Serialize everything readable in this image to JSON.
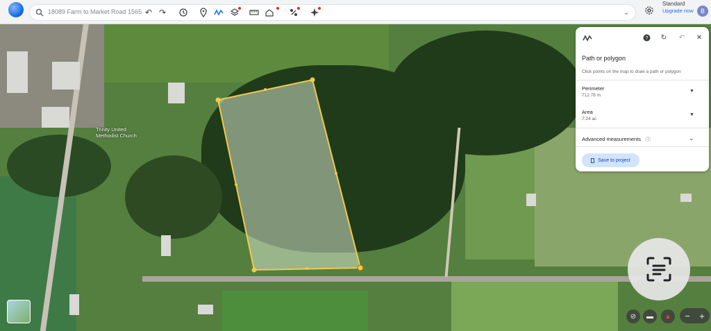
{
  "search": {
    "value": "18089 Farm to Market Road 1565"
  },
  "toolbar": {
    "tools": [
      "undo-icon",
      "redo-icon",
      "history-icon",
      "pin-icon",
      "path-icon",
      "layers-icon",
      "ruler-icon",
      "voyager-icon",
      "data-layers-icon",
      "ai-sparkle-icon"
    ]
  },
  "account": {
    "plan": "Standard",
    "upgrade_label": "Upgrade now",
    "avatar_letter": "B"
  },
  "measure_panel": {
    "title": "Path or polygon",
    "instruction": "Click points on the map to draw a path or polygon",
    "perimeter_label": "Perimeter",
    "perimeter_value": "712.78 m",
    "area_label": "Area",
    "area_value": "7.24 ac",
    "advanced_label": "Advanced measurements",
    "save_label": "Save to project"
  },
  "map": {
    "church_label": "Trinity United Methodist Church",
    "polygon_color": "#f2c94c"
  },
  "colors": {
    "accent": "#1a73e8",
    "save_bg": "#d2e3fc"
  }
}
